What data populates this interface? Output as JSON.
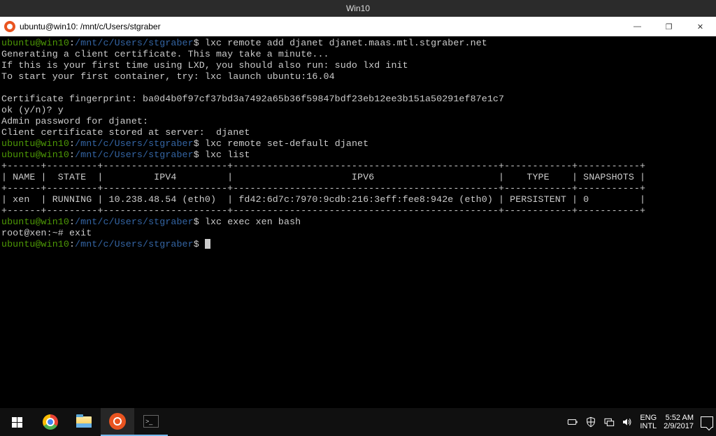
{
  "vm": {
    "title": "Win10"
  },
  "window": {
    "title": "ubuntu@win10: /mnt/c/Users/stgraber"
  },
  "prompt": {
    "user": "ubuntu@win10",
    "path": "/mnt/c/Users/stgraber",
    "sep1": ":",
    "sep2": "$"
  },
  "root_prompt": "root@xen:~#",
  "cmds": {
    "c1": " lxc remote add djanet djanet.maas.mtl.stgraber.net",
    "c2": " lxc remote set-default djanet",
    "c3": " lxc list",
    "c4": " lxc exec xen bash",
    "c5_exit": " exit"
  },
  "out": {
    "l1": "Generating a client certificate. This may take a minute...",
    "l2": "If this is your first time using LXD, you should also run: sudo lxd init",
    "l3": "To start your first container, try: lxc launch ubuntu:16.04",
    "l4": "",
    "l5": "Certificate fingerprint: ba0d4b0f97cf37bd3a7492a65b36f59847bdf23eb12ee3b151a50291ef87e1c7",
    "l6": "ok (y/n)? y",
    "l7": "Admin password for djanet:",
    "l8": "Client certificate stored at server:  djanet"
  },
  "table": {
    "border_top": "+------+---------+----------------------+-----------------------------------------------+------------+-----------+",
    "header": "| NAME |  STATE  |         IPV4         |                     IPV6                      |    TYPE    | SNAPSHOTS |",
    "row": "| xen  | RUNNING | 10.238.48.54 (eth0)  | fd42:6d7c:7970:9cdb:216:3eff:fee8:942e (eth0) | PERSISTENT | 0         |"
  },
  "taskbar": {
    "lang1": "ENG",
    "lang2": "INTL",
    "time": "5:52 AM",
    "date": "2/9/2017"
  }
}
